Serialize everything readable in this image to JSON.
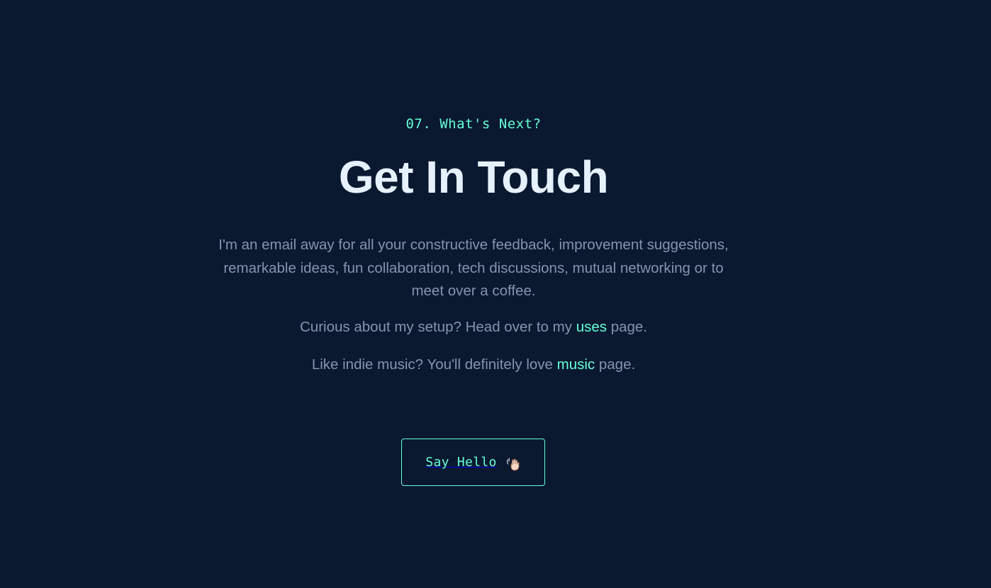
{
  "contact": {
    "overline": "07. What's Next?",
    "title": "Get In Touch",
    "intro": "I'm an email away for all your constructive feedback, improvement suggestions, remarkable ideas, fun collaboration, tech discussions, mutual networking or to meet over a coffee.",
    "setup_prefix": "Curious about my setup? Head over to my ",
    "setup_link": "uses",
    "setup_suffix": " page.",
    "music_prefix": "Like indie music? You'll definitely love ",
    "music_link": "music",
    "music_suffix": " page.",
    "button_label": "Say Hello",
    "button_icon": "waving-hand-icon"
  },
  "colors": {
    "background": "#0a192f",
    "accent": "#64ffda",
    "heading": "#e6f1ff",
    "body_text": "#8892b0"
  }
}
